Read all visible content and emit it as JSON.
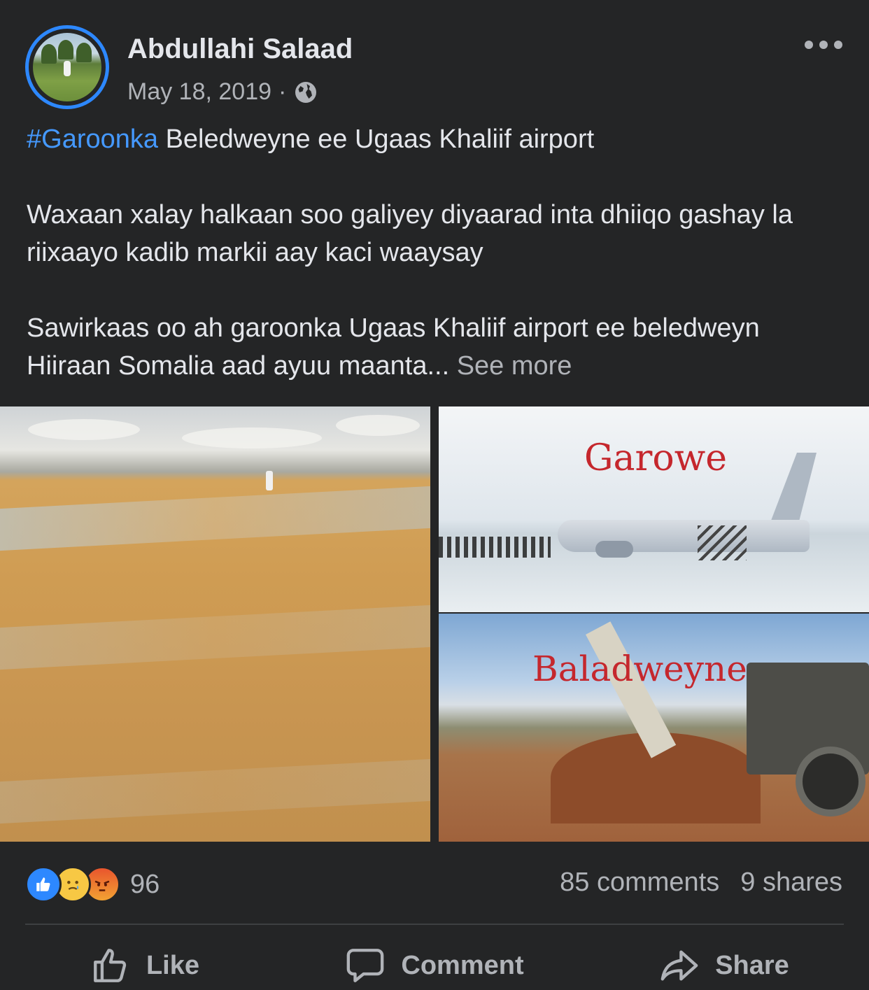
{
  "post": {
    "author": "Abdullahi Salaad",
    "date": "May 18, 2019",
    "separator": "·",
    "privacy_icon": "globe-icon",
    "text": {
      "hashtag": "#Garoonka",
      "line1_rest": " Beledweyne ee Ugaas Khaliif airport",
      "paragraph2": "Waxaan xalay halkaan soo galiyey diyaarad inta dhiiqo gashay la riixaayo kadib markii aay kaci waaysay",
      "paragraph3": "Sawirkaas oo ah garoonka Ugaas Khaliif airport ee beledweyn Hiiraan Somalia aad ayuu maanta...",
      "see_more": "See more"
    },
    "photos": {
      "top_right_caption": "Garowe",
      "bottom_right_caption": "Baladweyne"
    }
  },
  "engagement": {
    "reactions": [
      "like-icon",
      "sad-icon",
      "angry-icon"
    ],
    "reaction_count": "96",
    "comments": "85 comments",
    "shares": "9 shares"
  },
  "actions": {
    "like": "Like",
    "comment": "Comment",
    "share": "Share"
  },
  "colors": {
    "background": "#242526",
    "link": "#4599ff",
    "avatar_ring": "#2d88ff",
    "caption_red": "#c5272d"
  }
}
